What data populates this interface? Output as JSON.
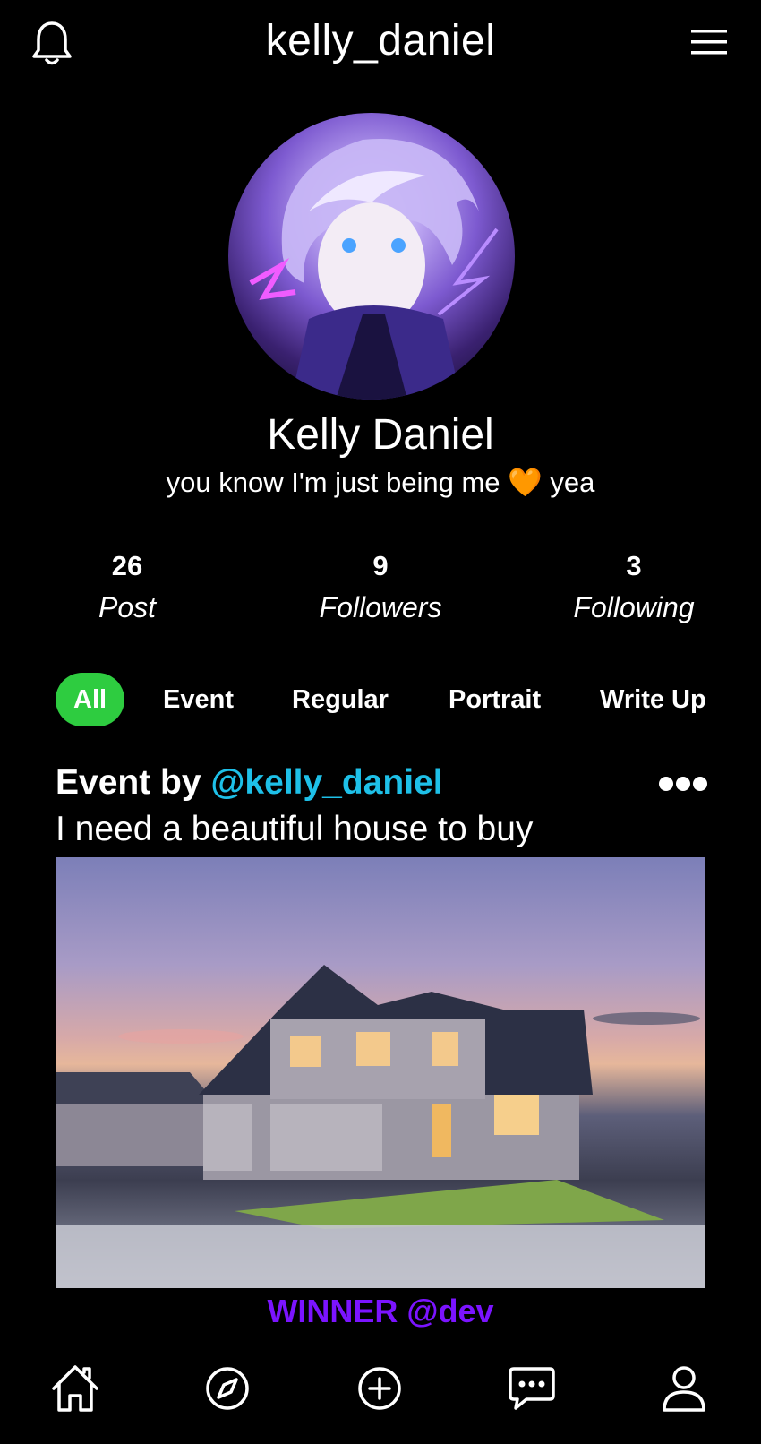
{
  "header": {
    "username": "kelly_daniel",
    "notifications_icon": "bell-icon",
    "menu_icon": "hamburger-menu-icon"
  },
  "profile": {
    "full_name": "Kelly Daniel",
    "bio": "you know I'm just  being me 🧡 yea",
    "stats": [
      {
        "value": "26",
        "label": "Post"
      },
      {
        "value": "9",
        "label": "Followers"
      },
      {
        "value": "3",
        "label": "Following"
      }
    ]
  },
  "tabs": [
    {
      "label": "All",
      "active": true
    },
    {
      "label": "Event",
      "active": false
    },
    {
      "label": "Regular",
      "active": false
    },
    {
      "label": "Portrait",
      "active": false
    },
    {
      "label": "Write Up",
      "active": false
    }
  ],
  "post": {
    "prefix": "Event by",
    "author_handle": "@kelly_daniel",
    "text": "I need a beautiful house to buy",
    "winner": "WINNER @dev"
  },
  "nav": [
    "home-icon",
    "compass-icon",
    "add-circle-icon",
    "chat-icon",
    "profile-icon"
  ],
  "colors": {
    "accent_green": "#2ecc40",
    "handle_blue": "#1ec0e8",
    "winner_purple": "#7b14ff",
    "background": "#000000"
  }
}
